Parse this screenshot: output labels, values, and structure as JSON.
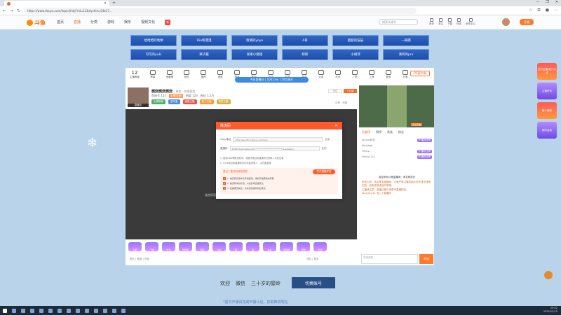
{
  "browser": {
    "tab_title": "",
    "url": "https://www.douyu.com/topic/jfnbj?rid=12&dyshid=54b17...",
    "window_controls": [
      "—",
      "❐",
      "✕"
    ]
  },
  "site": {
    "logo": "斗鱼",
    "nav": [
      "首页",
      "直播",
      "分类",
      "游戏",
      "娱乐",
      "视频文化"
    ],
    "nav_badge": "新",
    "search_placeholder": "搜索关键字",
    "header_icons": [
      "历史",
      "关注",
      "下载",
      "任务",
      "创作中心"
    ],
    "live_button": "开播"
  },
  "categories": [
    "哈哈哈的地球",
    "Dio和漫漫",
    "清清的yoyo",
    "A哥",
    "肥肥的猫猫",
    "一锅粥",
    "可可的yuki",
    "栗子酱",
    "果果小猪猪",
    "粽粽",
    "小胡萍",
    "清风的pro"
  ],
  "panel": {
    "level": "12",
    "level_sub": "主播等级",
    "icons": [
      "等级",
      "贡献榜",
      "背包",
      "推荐",
      "语音",
      "粉丝",
      "签到",
      "活动",
      "礼物",
      "任务",
      "公告",
      "红包",
      "广场",
      "工具",
      "更多",
      "分享"
    ],
    "pc_button": "PC客户端",
    "banner": "今日首播日 | 10017元 | 50位观众",
    "streamer_name": "燃烧燃烧燃烧",
    "streamer_category": "单机 · 其他游戏",
    "streamer_meta": [
      "房间号 123",
      "主播等级",
      "热度 123",
      "粉丝 1.2万"
    ],
    "streamer_tags": [
      "大神推荐",
      "超可爱",
      "高能主播",
      "新人主播",
      "搞笑主播"
    ],
    "avatar_tag": "直播中",
    "follow": "关注",
    "subscribe": "+订阅",
    "share": "分享 · 举报",
    "video_loading": "该房间暂时无人",
    "gifts": [
      "火箭",
      "飞机",
      "办卡",
      "荧光棒",
      "弱鸡",
      "666",
      "赞",
      "稳",
      "鱼丸",
      "棒棒糖",
      "宝箱",
      "礼包"
    ],
    "gift_info": "鱼丸  |  鱼翅  |  充值",
    "gift_right": "背包  |  更多"
  },
  "rightcol": {
    "mini_label": "正在直播",
    "tabs": [
      "贡献榜",
      "周榜",
      "贵族",
      "粉丝"
    ],
    "rank": [
      {
        "name": "Akuya 粉丝",
        "badge": "开通粉丝牌"
      },
      {
        "name": "Akuyagk",
        "badge": ""
      },
      {
        "name": "Hmuy...",
        "badge": "开通粉丝牌"
      },
      {
        "name": "Hmuy1211",
        "badge": "开通粉丝牌"
      }
    ],
    "chat_notice": "欢迎来到斗鱼直播间 · 请文明发言",
    "chat_lines": [
      "系统公告：欢迎来到直播间，斗鱼严禁主播或观众发布违法违规内容，如有发现请及时举报。",
      "主播请注意：直播过程中请遵守直播规范。",
      "Akuya1211 进入了直播间"
    ],
    "chat_placeholder": "发送弹幕",
    "send": "发送"
  },
  "modal": {
    "title": "推流码",
    "close": "×",
    "server_label": "rtmp地址",
    "server_value": "rtmp://sendtc3.douyu.com/live",
    "key_label": "直播码",
    "key_value": "1585/10a4?wsSecret=**************************&wsSeek=",
    "copy": "复制",
    "note1": "1. 使用OBS等推流软件，将推流地址和直播码分别填入对应位置",
    "note2": "2. rtmp地址和直播码请勿泄露给他人，以防被盗播",
    "tip_title": "重点！推流码使用须知",
    "tip_button": "打开直播伴侣",
    "tip_lines": [
      "1. 推流码仅限本次开播使用，重新开播需重新获取",
      "2. 推流码请勿外泄，以免影响直播安全",
      "3. 如遇推流失败，请关闭直播伴侣后重试"
    ]
  },
  "ads": [
    "活力主播 能力认证",
    "主播任务",
    "新人福利",
    "限时活动"
  ],
  "welcome": {
    "text1": "欢迎",
    "text2": "微信",
    "name": "三十岁的屋岭",
    "switch": "切换账号"
  },
  "bottom_tip": "*首次开播请完成开播认证，获取推流地址",
  "tray": {
    "time": "20:02",
    "date": "2025/12/15"
  }
}
